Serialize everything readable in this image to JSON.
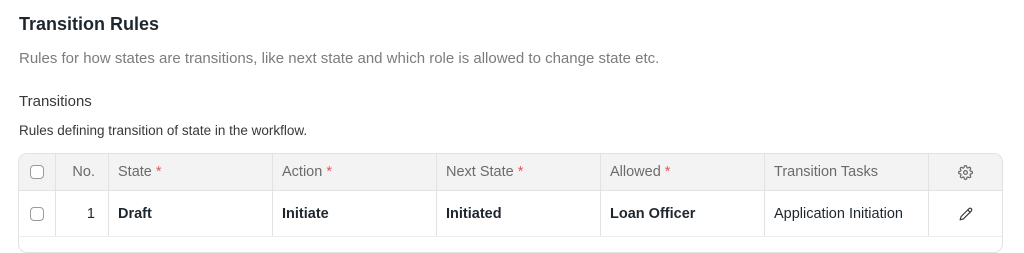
{
  "section": {
    "title": "Transition Rules",
    "description": "Rules for how states are transitions, like next state and which role is allowed to change state etc."
  },
  "field": {
    "label": "Transitions",
    "description": "Rules defining transition of state in the workflow."
  },
  "table": {
    "columns": {
      "no": "No.",
      "state": "State",
      "action": "Action",
      "next_state": "Next State",
      "allowed": "Allowed",
      "transition_tasks": "Transition Tasks"
    },
    "required_marker": "*",
    "rows": [
      {
        "no": "1",
        "state": "Draft",
        "action": "Initiate",
        "next_state": "Initiated",
        "allowed": "Loan Officer",
        "transition_tasks": "Application Initiation"
      }
    ]
  },
  "icons": {
    "settings": "gear-icon",
    "edit": "pencil-icon"
  },
  "colors": {
    "required": "#e2595e",
    "header_bg": "#f3f3f3",
    "muted_text": "#7c7c7c"
  }
}
